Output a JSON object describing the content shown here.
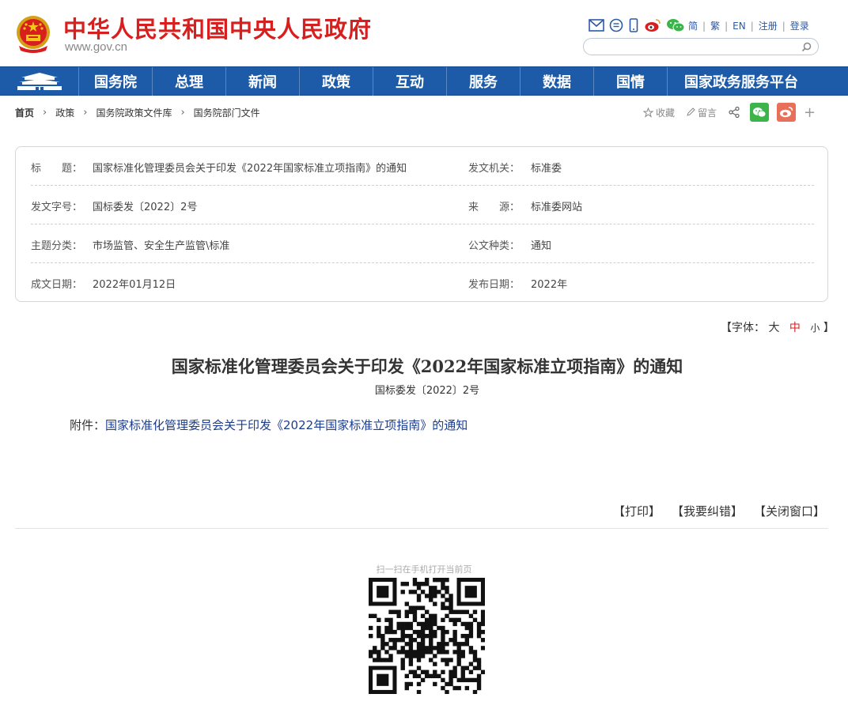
{
  "header": {
    "site_title": "中华人民共和国中央人民政府",
    "site_url": "www.gov.cn",
    "top_icons": [
      "mail-icon",
      "chat-icon",
      "mobile-icon",
      "weibo-icon",
      "wechat-icon"
    ],
    "lang_links": [
      "简",
      "繁",
      "EN",
      "注册",
      "登录"
    ],
    "search_placeholder": ""
  },
  "nav": {
    "items": [
      "国务院",
      "总理",
      "新闻",
      "政策",
      "互动",
      "服务",
      "数据",
      "国情",
      "国家政务服务平台"
    ]
  },
  "breadcrumb": [
    "首页",
    "政策",
    "国务院政策文件库",
    "国务院部门文件"
  ],
  "tools": {
    "favorite": "收藏",
    "message": "留言"
  },
  "info": {
    "rows": [
      {
        "l1": "标　　题：",
        "v1": "国家标准化管理委员会关于印发《2022年国家标准立项指南》的通知",
        "l2": "发文机关：",
        "v2": "标准委"
      },
      {
        "l1": "发文字号：",
        "v1": "国标委发〔2022〕2号",
        "l2": "来　　源：",
        "v2": "标准委网站"
      },
      {
        "l1": "主题分类：",
        "v1": "市场监管、安全生产监管\\标准",
        "l2": "公文种类：",
        "v2": "通知"
      },
      {
        "l1": "成文日期：",
        "v1": "2022年01月12日",
        "l2": "发布日期：",
        "v2": "2022年"
      }
    ]
  },
  "fontsize": {
    "label": "【字体：",
    "large": "大",
    "medium": "中",
    "small": "小",
    "close": "】"
  },
  "doc": {
    "title": "国家标准化管理委员会关于印发《2022年国家标准立项指南》的通知",
    "number": "国标委发〔2022〕2号",
    "attachment_label": "附件：",
    "attachment_link": "国家标准化管理委员会关于印发《2022年国家标准立项指南》的通知"
  },
  "actions": [
    "【打印】",
    "【我要纠错】",
    "【关闭窗口】"
  ],
  "qr": {
    "caption": "扫一扫在手机打开当前页"
  },
  "colors": {
    "brand_red": "#d71f1f",
    "nav_blue": "#1d5ba8",
    "link_blue": "#1a3d8f",
    "wechat_green": "#3bb54a",
    "weibo_red": "#e8705a"
  }
}
